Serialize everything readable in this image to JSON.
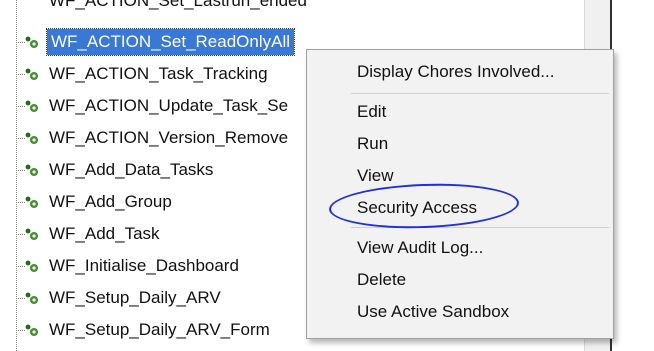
{
  "tree": {
    "items": [
      {
        "label": "WF_ACTION_Set_Lastrun_ended"
      },
      {
        "label": "WF_ACTION_Set_ReadOnlyAll"
      },
      {
        "label": "WF_ACTION_Task_Tracking"
      },
      {
        "label": "WF_ACTION_Update_Task_Se"
      },
      {
        "label": "WF_ACTION_Version_Remove"
      },
      {
        "label": "WF_Add_Data_Tasks"
      },
      {
        "label": "WF_Add_Group"
      },
      {
        "label": "WF_Add_Task"
      },
      {
        "label": "WF_Initialise_Dashboard"
      },
      {
        "label": "WF_Setup_Daily_ARV"
      },
      {
        "label": "WF_Setup_Daily_ARV_Form"
      }
    ],
    "selected_index": 1,
    "icon": "workflow-gear-icon",
    "icon_colors": {
      "gear": "#3f8f2a",
      "dot": "#1f6d14"
    }
  },
  "context_menu": {
    "items": [
      {
        "label": "Display Chores Involved..."
      },
      {
        "label": "Edit"
      },
      {
        "label": "Run"
      },
      {
        "label": "View"
      },
      {
        "label": "Security Access",
        "annotated": true
      },
      {
        "label": "View Audit Log..."
      },
      {
        "label": "Delete"
      },
      {
        "label": "Use Active Sandbox"
      }
    ]
  },
  "annotation": {
    "shape": "hand-drawn-ellipse",
    "color": "#1e2ee0",
    "target": "Security Access"
  },
  "colors": {
    "selection": "#3a78d6",
    "menu_bg": "#f2f2f2"
  }
}
